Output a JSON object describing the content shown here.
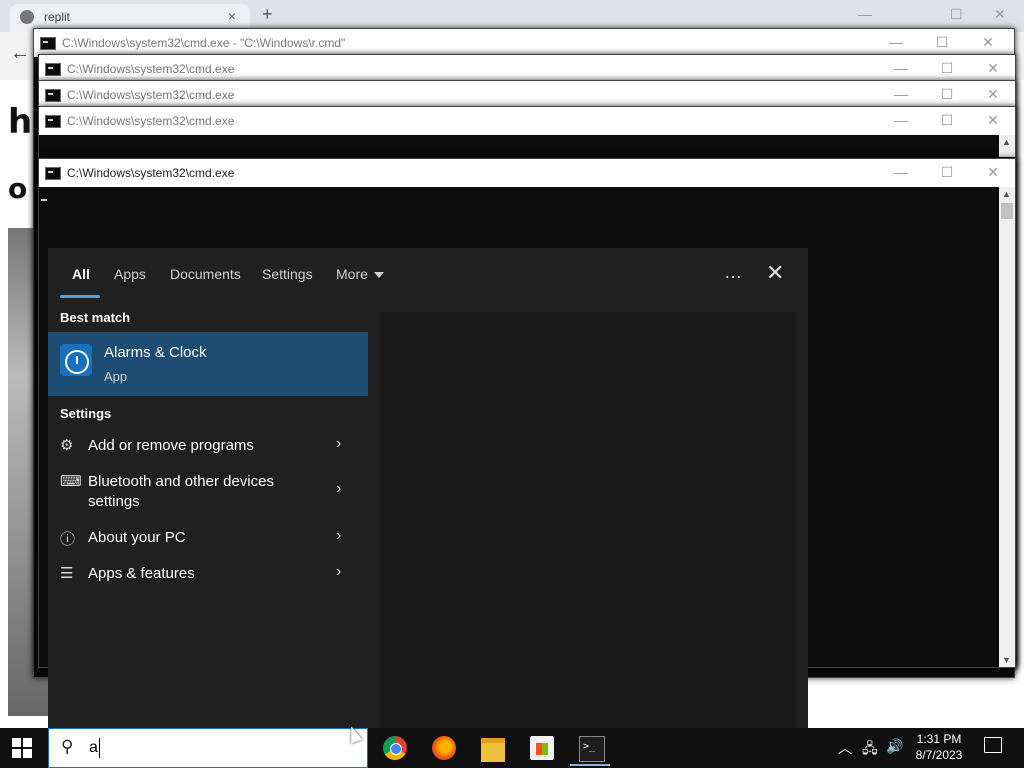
{
  "browser": {
    "tab_title": "replit",
    "tab_close": "×",
    "new_tab": "+",
    "back": "←",
    "page_heading_fragment": "h",
    "page_sub_fragment": "o"
  },
  "cmd_windows": [
    {
      "title": "C:\\Windows\\system32\\cmd.exe - \"C:\\Windows\\r.cmd\""
    },
    {
      "title": "C:\\Windows\\system32\\cmd.exe"
    },
    {
      "title": "C:\\Windows\\system32\\cmd.exe"
    },
    {
      "title": "C:\\Windows\\system32\\cmd.exe"
    },
    {
      "title": "C:\\Windows\\system32\\cmd.exe"
    }
  ],
  "window_controls": {
    "minimize": "—",
    "maximize": "☐",
    "close": "✕"
  },
  "search_panel": {
    "tabs": [
      "All",
      "Apps",
      "Documents",
      "Settings",
      "More"
    ],
    "active_tab": "All",
    "options_icon": "…",
    "close_icon": "✕",
    "best_match_heading": "Best match",
    "best_match": {
      "name": "Alarms & Clock",
      "type": "App",
      "icon": "alarm-clock-icon"
    },
    "settings_heading": "Settings",
    "settings_items": [
      {
        "label": "Add or remove programs",
        "icon": "gear-icon"
      },
      {
        "label": "Bluetooth and other devices settings",
        "icon": "devices-icon"
      },
      {
        "label": "About your PC",
        "icon": "info-icon"
      },
      {
        "label": "Apps & features",
        "icon": "list-icon"
      }
    ]
  },
  "taskbar": {
    "search_value": "a",
    "apps": [
      "chrome",
      "firefox",
      "file-explorer",
      "microsoft-store",
      "terminal"
    ],
    "clock_time": "1:31 PM",
    "clock_date": "8/7/2023"
  },
  "colors": {
    "accent": "#1f4c73",
    "panel_bg": "#202020",
    "tab_underline": "#4ca0e0"
  }
}
